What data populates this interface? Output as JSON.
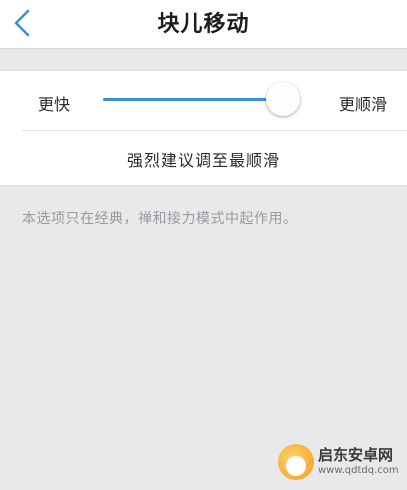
{
  "header": {
    "back_icon": "chevron-left-icon",
    "title": "块儿移动"
  },
  "speed_setting": {
    "left_label": "更快",
    "right_label": "更顺滑",
    "slider_value": 1.0,
    "accent_color": "#3b8fd6",
    "recommendation": "强烈建议调至最顺滑"
  },
  "note": "本选项只在经典，禅和接力模式中起作用。",
  "watermark": {
    "brand": "启东安卓网",
    "url": "www.qdtdq.com"
  }
}
